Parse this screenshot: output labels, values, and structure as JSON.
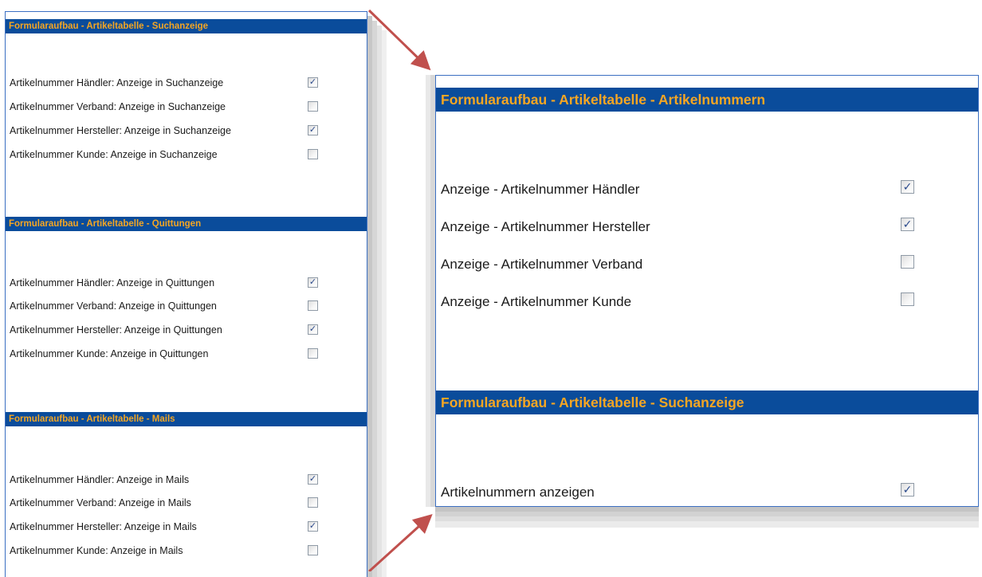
{
  "left_panel": {
    "sections": [
      {
        "title": "Formularaufbau - Artikeltabelle - Suchanzeige",
        "rows": [
          {
            "label": "Artikelnummer Händler: Anzeige in Suchanzeige",
            "checked": true
          },
          {
            "label": "Artikelnummer Verband: Anzeige in Suchanzeige",
            "checked": false
          },
          {
            "label": "Artikelnummer Hersteller: Anzeige in Suchanzeige",
            "checked": true
          },
          {
            "label": "Artikelnummer Kunde: Anzeige in Suchanzeige",
            "checked": false
          }
        ]
      },
      {
        "title": "Formularaufbau - Artikeltabelle - Quittungen",
        "rows": [
          {
            "label": "Artikelnummer Händler: Anzeige in Quittungen",
            "checked": true
          },
          {
            "label": "Artikelnummer Verband: Anzeige in Quittungen",
            "checked": false
          },
          {
            "label": "Artikelnummer Hersteller: Anzeige in Quittungen",
            "checked": true
          },
          {
            "label": "Artikelnummer Kunde: Anzeige in Quittungen",
            "checked": false
          }
        ]
      },
      {
        "title": "Formularaufbau - Artikeltabelle - Mails",
        "rows": [
          {
            "label": "Artikelnummer Händler: Anzeige in Mails",
            "checked": true
          },
          {
            "label": "Artikelnummer Verband: Anzeige in Mails",
            "checked": false
          },
          {
            "label": "Artikelnummer Hersteller: Anzeige in Mails",
            "checked": true
          },
          {
            "label": "Artikelnummer Kunde: Anzeige in Mails",
            "checked": false
          }
        ]
      }
    ]
  },
  "right_panel": {
    "sections": [
      {
        "title": "Formularaufbau - Artikeltabelle - Artikelnummern",
        "rows": [
          {
            "label": "Anzeige - Artikelnummer Händler",
            "checked": true
          },
          {
            "label": "Anzeige - Artikelnummer Hersteller",
            "checked": true
          },
          {
            "label": "Anzeige - Artikelnummer Verband",
            "checked": false
          },
          {
            "label": "Anzeige - Artikelnummer Kunde",
            "checked": false
          }
        ]
      },
      {
        "title": "Formularaufbau - Artikeltabelle - Suchanzeige",
        "rows": [
          {
            "label": "Artikelnummern anzeigen",
            "checked": true
          }
        ]
      }
    ]
  },
  "colors": {
    "header_bg": "#0a4c9b",
    "header_text": "#f5a623",
    "panel_border": "#3b6fc2",
    "arrow": "#c0504d"
  },
  "icons": {
    "check": "checkmark-icon",
    "arrow": "arrow-icon"
  }
}
